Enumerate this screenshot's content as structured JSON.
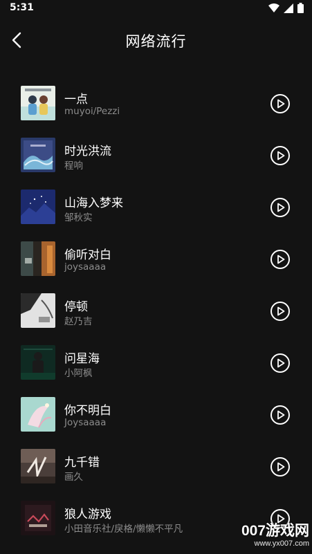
{
  "status": {
    "time": "5:31"
  },
  "header": {
    "title": "网络流行"
  },
  "songs": [
    {
      "title": "一点",
      "artist": "muyoi/Pezzi"
    },
    {
      "title": "时光洪流",
      "artist": "程响"
    },
    {
      "title": "山海入梦来",
      "artist": "邹秋实"
    },
    {
      "title": "偷听对白",
      "artist": "joysaaaa"
    },
    {
      "title": "停顿",
      "artist": "赵乃吉"
    },
    {
      "title": "问星海",
      "artist": "小阿枫"
    },
    {
      "title": "你不明白",
      "artist": "Joysaaaa"
    },
    {
      "title": "九千错",
      "artist": "画久"
    },
    {
      "title": "狼人游戏",
      "artist": "小田音乐社/戾格/懒懒不平凡"
    }
  ],
  "watermark": {
    "main": "007游戏网",
    "url": "www.yx007.com"
  },
  "colors": {
    "background": "#131313",
    "text": "#ffffff",
    "secondary_text": "#8c8c8c"
  },
  "icons": {
    "back": "chevron-left-icon",
    "play": "play-circle-icon",
    "wifi": "wifi-icon",
    "signal": "signal-icon",
    "battery": "battery-icon"
  }
}
